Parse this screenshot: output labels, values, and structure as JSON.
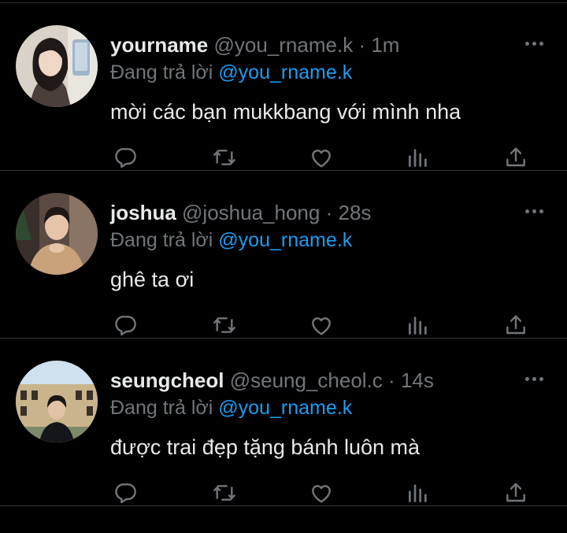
{
  "reply_prefix": "Đang trả lời",
  "colors": {
    "background": "#000000",
    "text": "#e7e9ea",
    "muted": "#71767b",
    "accent": "#1d9bf0",
    "divider": "#2f3336"
  },
  "icons": {
    "reply": "reply-icon",
    "retweet": "retweet-icon",
    "like": "heart-icon",
    "views": "views-icon",
    "share": "share-icon",
    "more": "more-icon"
  },
  "tweets": [
    {
      "name": "yourname",
      "handle": "@you_rname.k",
      "separator": "·",
      "time": "1m",
      "replying_to": "@you_rname.k",
      "text": "mời các bạn mukkbang với mình nha"
    },
    {
      "name": "joshua",
      "handle": "@joshua_hong",
      "separator": "·",
      "time": "28s",
      "replying_to": "@you_rname.k",
      "text": "ghê ta ơi"
    },
    {
      "name": "seungcheol",
      "handle": "@seung_cheol.c",
      "separator": "·",
      "time": "14s",
      "replying_to": "@you_rname.k",
      "text": "được trai đẹp tặng bánh luôn mà"
    }
  ]
}
